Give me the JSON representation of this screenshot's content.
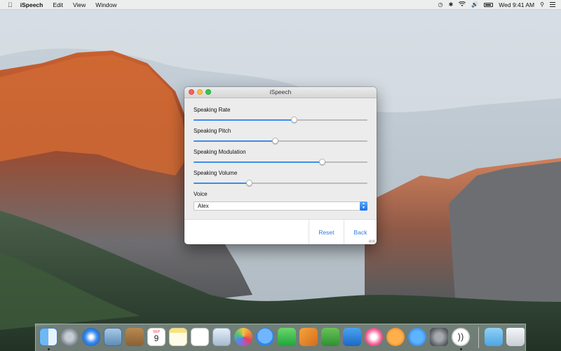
{
  "menubar": {
    "app_name": "iSpeech",
    "menus": [
      "Edit",
      "View",
      "Window"
    ],
    "clock": "Wed 9:41 AM"
  },
  "window": {
    "title": "iSpeech",
    "settings": [
      {
        "label": "Speaking Rate",
        "value_percent": 58
      },
      {
        "label": "Speaking Pitch",
        "value_percent": 47
      },
      {
        "label": "Speaking Modulation",
        "value_percent": 74
      },
      {
        "label": "Speaking Volume",
        "value_percent": 32
      }
    ],
    "voice_label": "Voice",
    "voice_value": "Alex",
    "buttons": {
      "reset": "Reset",
      "back": "Back"
    }
  },
  "dock": {
    "apps": [
      "finder-icon",
      "launchpad-icon",
      "safari-icon",
      "mail-icon",
      "contacts-icon",
      "calendar-icon",
      "notes-icon",
      "reminders-icon",
      "preview-icon",
      "photos-icon",
      "messages-icon",
      "facetime-icon",
      "pages-icon",
      "numbers-icon",
      "keynote-icon",
      "itunes-icon",
      "ibooks-icon",
      "app-store-icon",
      "system-preferences-icon",
      "ispeech-icon",
      "downloads-folder-icon",
      "trash-icon"
    ],
    "calendar_month": "SEP",
    "calendar_day": "9"
  }
}
